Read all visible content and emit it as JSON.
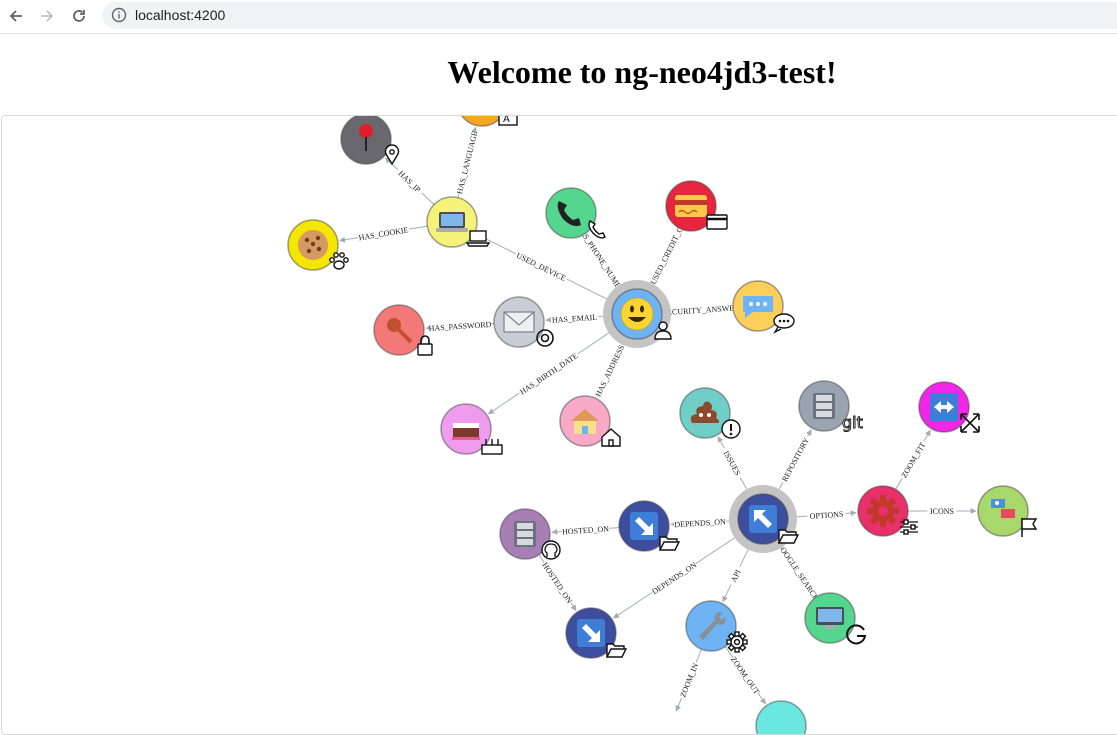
{
  "browser": {
    "url": "localhost:4200",
    "back_icon": "arrow-left-icon",
    "forward_icon": "arrow-right-icon",
    "reload_icon": "reload-icon",
    "info_icon": "info-icon"
  },
  "page": {
    "title": "Welcome to ng-neo4jd3-test!"
  },
  "graph": {
    "relationships": [
      {
        "id": "r1",
        "label": "HAS_IP"
      },
      {
        "id": "r2",
        "label": "HAS_LANGUAGE"
      },
      {
        "id": "r3",
        "label": "HAS_COOKIE"
      },
      {
        "id": "r4",
        "label": "USED_DEVICE"
      },
      {
        "id": "r5",
        "label": "HAS_PHONE_NUMBER"
      },
      {
        "id": "r6",
        "label": "HAS_USED_CREDIT_CARD"
      },
      {
        "id": "r7",
        "label": "HAS_EMAIL"
      },
      {
        "id": "r8",
        "label": "SECURITY_ANSWER"
      },
      {
        "id": "r9",
        "label": "HAS_PASSWORD"
      },
      {
        "id": "r10",
        "label": "HAS_BIRTH_DATE"
      },
      {
        "id": "r11",
        "label": "HAS_ADDRESS"
      },
      {
        "id": "r12",
        "label": "ISSUES"
      },
      {
        "id": "r13",
        "label": "REPOSITORY"
      },
      {
        "id": "r14",
        "label": "ZOOM_FIT"
      },
      {
        "id": "r15",
        "label": "HOSTED_ON"
      },
      {
        "id": "r16",
        "label": "DEPENDS_ON"
      },
      {
        "id": "r17",
        "label": "OPTIONS"
      },
      {
        "id": "r18",
        "label": "ICONS"
      },
      {
        "id": "r19",
        "label": "HOSTED_ON"
      },
      {
        "id": "r20",
        "label": "DEPENDS_ON"
      },
      {
        "id": "r21",
        "label": "API"
      },
      {
        "id": "r22",
        "label": "GOOGLE_SEARCH"
      },
      {
        "id": "r23",
        "label": "ZOOM_IN"
      },
      {
        "id": "r24",
        "label": "ZOOM_OUT"
      }
    ],
    "nodes": [
      {
        "id": "ip",
        "fill": "#68686e",
        "emoji": "pin",
        "icon": "map-marker-icon"
      },
      {
        "id": "language",
        "fill": "#f5a623",
        "emoji": "language",
        "icon": "language-icon"
      },
      {
        "id": "device",
        "fill": "#f5f27a",
        "emoji": "laptop",
        "icon": "laptop-icon"
      },
      {
        "id": "cookie",
        "fill": "#f5e600",
        "emoji": "cookie",
        "icon": "paw-icon"
      },
      {
        "id": "phone",
        "fill": "#55d68f",
        "emoji": "phone",
        "icon": "phone-icon"
      },
      {
        "id": "credit-card",
        "fill": "#e8253e",
        "emoji": "credit-card",
        "icon": "credit-card-icon"
      },
      {
        "id": "user",
        "fill": "#6eb4f5",
        "emoji": "smiley",
        "icon": "user-icon"
      },
      {
        "id": "email",
        "fill": "#c9ced6",
        "emoji": "envelope",
        "icon": "at-icon"
      },
      {
        "id": "security",
        "fill": "#fccf5a",
        "emoji": "speech-bubble",
        "icon": "comment-icon"
      },
      {
        "id": "password",
        "fill": "#f57878",
        "emoji": "key",
        "icon": "lock-icon"
      },
      {
        "id": "birthday",
        "fill": "#ef9cef",
        "emoji": "cake",
        "icon": "birthday-cake-icon"
      },
      {
        "id": "address",
        "fill": "#f8a9c6",
        "emoji": "house",
        "icon": "home-icon"
      },
      {
        "id": "issues",
        "fill": "#6fcfc8",
        "emoji": "pile",
        "icon": "exclamation-circle-icon"
      },
      {
        "id": "repository",
        "fill": "#9aa3b0",
        "emoji": "file-cabinet",
        "icon": "git-icon"
      },
      {
        "id": "zoom-fit",
        "fill": "#f126e6",
        "emoji": "left-right-arrow",
        "icon": "arrows-alt-icon"
      },
      {
        "id": "project",
        "fill": "#3d4e9e",
        "emoji": "arrow-up-left",
        "icon": "folder-open-icon"
      },
      {
        "id": "options",
        "fill": "#e8306a",
        "emoji": "gear",
        "icon": "sliders-icon"
      },
      {
        "id": "icons",
        "fill": "#a8d86c",
        "emoji": "flags",
        "icon": "flag-icon"
      },
      {
        "id": "github",
        "fill": "#a87fb4",
        "emoji": "file-cabinet",
        "icon": "github-icon"
      },
      {
        "id": "dependency1",
        "fill": "#3d4e9e",
        "emoji": "arrow-down-right",
        "icon": "folder-open-icon"
      },
      {
        "id": "dependency2",
        "fill": "#3d4e9e",
        "emoji": "arrow-down-right",
        "icon": "folder-open-icon"
      },
      {
        "id": "api",
        "fill": "#6eb4f5",
        "emoji": "wrench",
        "icon": "cog-icon"
      },
      {
        "id": "google",
        "fill": "#55d68f",
        "emoji": "desktop",
        "icon": "google-icon"
      },
      {
        "id": "zoom-out",
        "fill": "#6ae8e0",
        "emoji": "",
        "icon": ""
      }
    ]
  }
}
